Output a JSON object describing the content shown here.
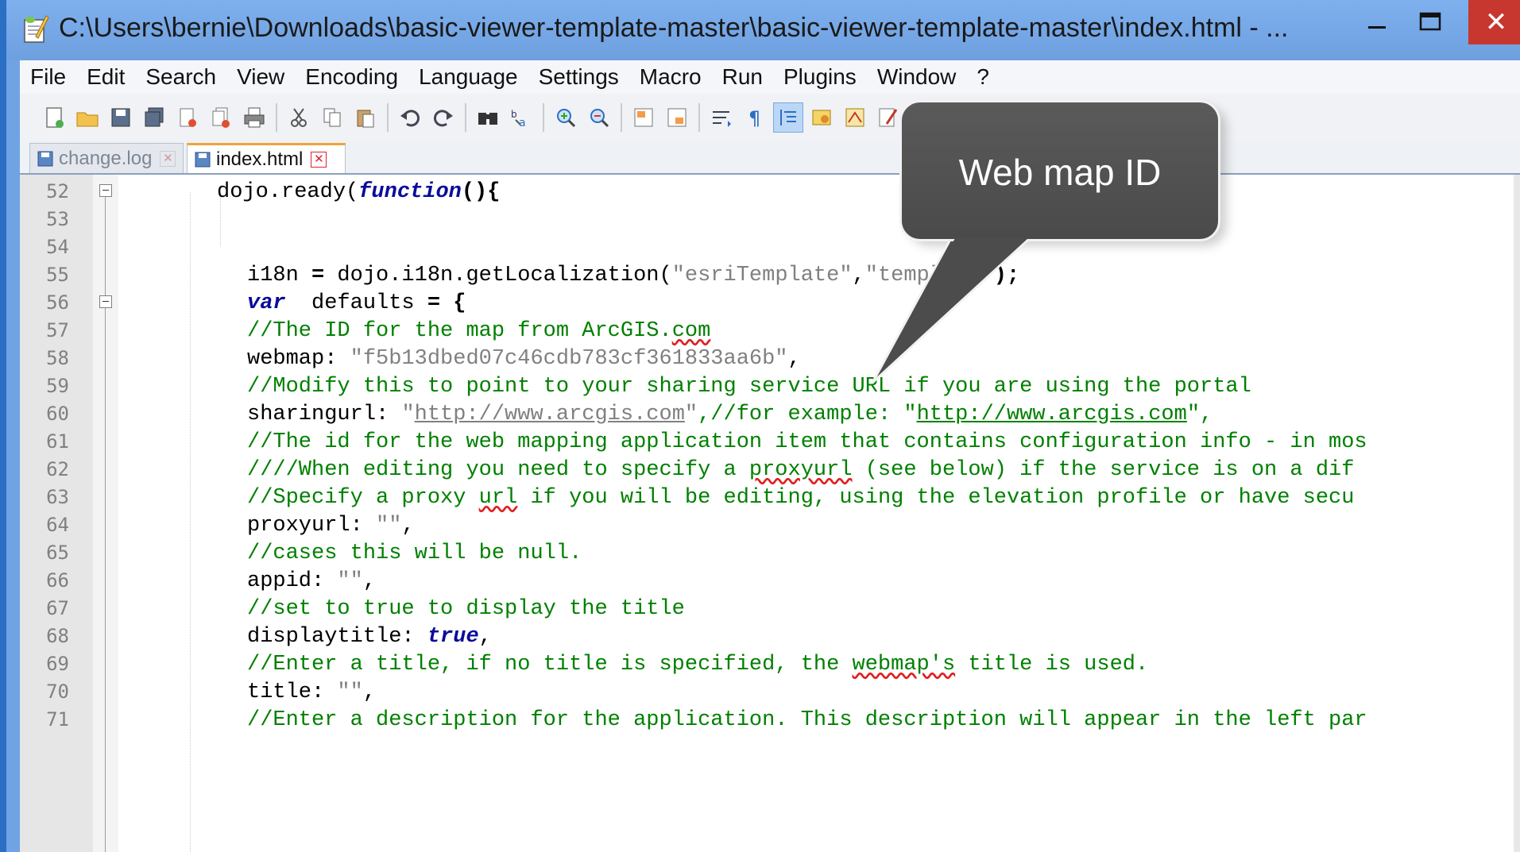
{
  "window": {
    "title": "C:\\Users\\bernie\\Downloads\\basic-viewer-template-master\\basic-viewer-template-master\\index.html - ...",
    "close_glyph": "✕"
  },
  "menu": [
    "File",
    "Edit",
    "Search",
    "View",
    "Encoding",
    "Language",
    "Settings",
    "Macro",
    "Run",
    "Plugins",
    "Window",
    "?"
  ],
  "tabs": [
    {
      "label": "change.log",
      "active": false
    },
    {
      "label": "index.html",
      "active": true
    }
  ],
  "callout": {
    "text": "Web map ID"
  },
  "editor": {
    "line_numbers": [
      "52",
      "53",
      "54",
      "55",
      "56",
      "57",
      "58",
      "59",
      "60",
      "61",
      "62",
      "63",
      "64",
      "65",
      "66",
      "67",
      "68",
      "69",
      "70",
      "71"
    ],
    "lines": {
      "l52": {
        "a": "dojo.ready(",
        "kw": "function",
        "b": "(){"
      },
      "l55": {
        "a": "i18n ",
        "op": "=",
        "b": " dojo.i18n.getLocalization(",
        "s1": "\"esriTemplate\"",
        "c": ",",
        "s2": "\"template\"",
        "d": ");"
      },
      "l56": {
        "kw": "var",
        "a": "  defaults ",
        "op": "=",
        "b": " {"
      },
      "l57": {
        "cm": "//The ID for the map from ArcGIS.",
        "spell": "com"
      },
      "l58": {
        "a": "webmap: ",
        "s": "\"f5b13dbed07c46cdb783cf361833aa6b\"",
        "b": ","
      },
      "l59": {
        "cm": "//Modify this to point to your sharing service URL if you are using the portal"
      },
      "l60": {
        "a": "sharingurl: ",
        "q1": "\"",
        "link1": "http://www.arcgis.com",
        "q2": "\"",
        "c1": ",//for example: \"",
        "link2": "http://www.arcgis.com",
        "c2": "\","
      },
      "l61": {
        "cm": "//The id for the web mapping application item that contains configuration info - in mos"
      },
      "l62": {
        "cm1": "////When editing you need to specify a ",
        "spell": "proxyurl",
        "cm2": " (see below) if the service is on a dif"
      },
      "l63": {
        "cm1": "//Specify a proxy ",
        "spell": "url",
        "cm2": " if you will be editing, using the elevation profile or have secu"
      },
      "l64": {
        "a": "proxyurl: ",
        "s": "\"\"",
        "b": ","
      },
      "l65": {
        "cm": "//cases this will be null."
      },
      "l66": {
        "a": "appid: ",
        "s": "\"\"",
        "b": ","
      },
      "l67": {
        "cm": "//set to true to display the title"
      },
      "l68": {
        "a": "displaytitle: ",
        "kw": "true",
        "b": ","
      },
      "l69": {
        "cm1": "//Enter a title, if no title is specified, the ",
        "spell": "webmap's",
        "cm2": " title is used."
      },
      "l70": {
        "a": "title: ",
        "s": "\"\"",
        "b": ","
      },
      "l71": {
        "cm": "//Enter a description for the application. This description will appear in the left par"
      }
    }
  }
}
